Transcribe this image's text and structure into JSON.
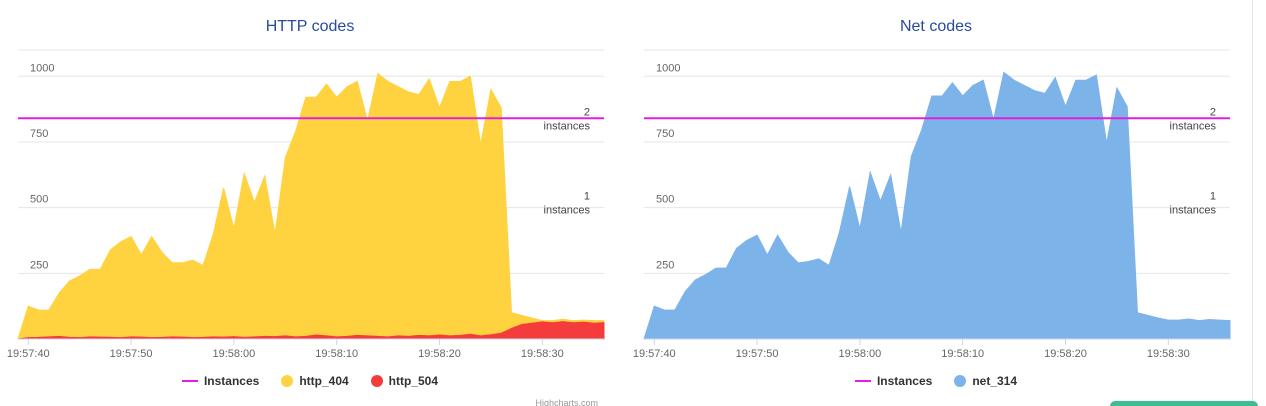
{
  "charts": [
    {
      "title": "HTTP codes",
      "credits": "Highcharts.com",
      "legend": [
        {
          "label": "Instances",
          "symbol": "line",
          "color": "#e020e0"
        },
        {
          "label": "http_404",
          "symbol": "dot",
          "color": "#ffd23f"
        },
        {
          "label": "http_504",
          "symbol": "dot",
          "color": "#f53c3c"
        }
      ],
      "plot_lines": [
        {
          "value": 840,
          "text_top": "2",
          "text_bottom": "instances"
        },
        {
          "value": 520,
          "text_top": "1",
          "text_bottom": "instances"
        }
      ]
    },
    {
      "title": "Net codes",
      "credits": "Highcharts.com",
      "legend": [
        {
          "label": "Instances",
          "symbol": "line",
          "color": "#e020e0"
        },
        {
          "label": "net_314",
          "symbol": "dot",
          "color": "#7cb3e8"
        }
      ],
      "plot_lines": [
        {
          "value": 840,
          "text_top": "2",
          "text_bottom": "instances"
        },
        {
          "value": 520,
          "text_top": "1",
          "text_bottom": "instances"
        }
      ]
    }
  ],
  "chart_data": [
    {
      "type": "area",
      "title": "HTTP codes",
      "x_ticks": [
        "19:57:40",
        "19:57:50",
        "19:58:00",
        "19:58:10",
        "19:58:20",
        "19:58:30"
      ],
      "y_ticks": [
        250,
        500,
        750,
        1000
      ],
      "ylim": [
        0,
        1100
      ],
      "x_range_seconds": [
        -1,
        56
      ],
      "x_tick_seconds": [
        0,
        10,
        20,
        30,
        40,
        50
      ],
      "series": [
        {
          "name": "http_404",
          "color": "#ffd23f",
          "x": [
            -1,
            0,
            1,
            2,
            3,
            4,
            5,
            6,
            7,
            8,
            9,
            10,
            11,
            12,
            13,
            14,
            15,
            16,
            17,
            18,
            19,
            20,
            21,
            22,
            23,
            24,
            25,
            26,
            27,
            28,
            29,
            30,
            31,
            32,
            33,
            34,
            35,
            36,
            37,
            38,
            39,
            40,
            41,
            42,
            43,
            44,
            45,
            46,
            47,
            48,
            49,
            50,
            51,
            52,
            53,
            54,
            55,
            56
          ],
          "values": [
            0,
            125,
            110,
            110,
            175,
            220,
            240,
            265,
            265,
            340,
            370,
            390,
            320,
            390,
            330,
            290,
            290,
            300,
            280,
            400,
            575,
            420,
            630,
            520,
            620,
            400,
            690,
            790,
            920,
            920,
            970,
            920,
            960,
            980,
            830,
            1010,
            980,
            960,
            940,
            930,
            990,
            880,
            980,
            980,
            1000,
            740,
            950,
            880,
            100,
            90,
            80,
            70,
            70,
            75,
            70,
            72,
            70,
            70
          ]
        },
        {
          "name": "http_504",
          "color": "#f53c3c",
          "x": [
            -1,
            0,
            1,
            2,
            3,
            4,
            5,
            6,
            7,
            8,
            9,
            10,
            11,
            12,
            13,
            14,
            15,
            16,
            17,
            18,
            19,
            20,
            21,
            22,
            23,
            24,
            25,
            26,
            27,
            28,
            29,
            30,
            31,
            32,
            33,
            34,
            35,
            36,
            37,
            38,
            39,
            40,
            41,
            42,
            43,
            44,
            45,
            46,
            47,
            48,
            49,
            50,
            51,
            52,
            53,
            54,
            55,
            56
          ],
          "values": [
            0,
            5,
            6,
            8,
            10,
            6,
            5,
            8,
            7,
            6,
            5,
            8,
            7,
            5,
            6,
            8,
            7,
            5,
            6,
            8,
            7,
            9,
            6,
            8,
            10,
            9,
            12,
            8,
            10,
            15,
            12,
            8,
            10,
            14,
            12,
            10,
            8,
            12,
            10,
            14,
            12,
            15,
            12,
            14,
            18,
            12,
            16,
            22,
            40,
            55,
            60,
            65,
            62,
            66,
            62,
            64,
            60,
            62
          ]
        }
      ]
    },
    {
      "type": "area",
      "title": "Net codes",
      "x_ticks": [
        "19:57:40",
        "19:57:50",
        "19:58:00",
        "19:58:10",
        "19:58:20",
        "19:58:30"
      ],
      "y_ticks": [
        250,
        500,
        750,
        1000
      ],
      "ylim": [
        0,
        1100
      ],
      "x_range_seconds": [
        -1,
        56
      ],
      "x_tick_seconds": [
        0,
        10,
        20,
        30,
        40,
        50
      ],
      "series": [
        {
          "name": "net_314",
          "color": "#7cb3e8",
          "x": [
            -1,
            0,
            1,
            2,
            3,
            4,
            5,
            6,
            7,
            8,
            9,
            10,
            11,
            12,
            13,
            14,
            15,
            16,
            17,
            18,
            19,
            20,
            21,
            22,
            23,
            24,
            25,
            26,
            27,
            28,
            29,
            30,
            31,
            32,
            33,
            34,
            35,
            36,
            37,
            38,
            39,
            40,
            41,
            42,
            43,
            44,
            45,
            46,
            47,
            48,
            49,
            50,
            51,
            52,
            53,
            54,
            55,
            56
          ],
          "values": [
            0,
            125,
            110,
            110,
            180,
            225,
            245,
            270,
            270,
            345,
            375,
            395,
            320,
            395,
            330,
            290,
            295,
            305,
            280,
            405,
            580,
            420,
            635,
            525,
            625,
            405,
            695,
            795,
            925,
            925,
            975,
            925,
            965,
            985,
            835,
            1015,
            985,
            965,
            945,
            935,
            995,
            885,
            985,
            985,
            1005,
            745,
            955,
            885,
            100,
            90,
            80,
            72,
            72,
            76,
            70,
            74,
            72,
            70
          ]
        }
      ]
    }
  ]
}
